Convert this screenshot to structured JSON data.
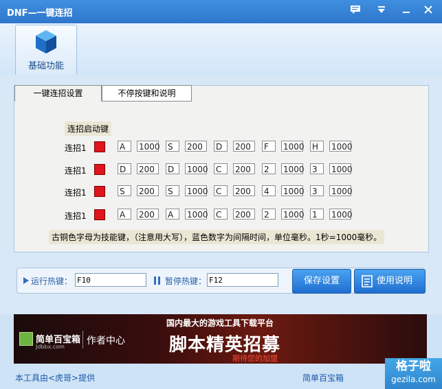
{
  "window": {
    "title": "DNF—一键连招"
  },
  "ribbon": {
    "tab_label": "基础功能"
  },
  "tabs": [
    {
      "label": "一键连招设置"
    },
    {
      "label": "不停按键和说明"
    }
  ],
  "combo": {
    "header": "连招启动键",
    "rows": [
      {
        "label": "连招1",
        "keys": [
          "A",
          "S",
          "D",
          "F",
          "H"
        ],
        "delays": [
          "1000",
          "200",
          "200",
          "1000",
          "1000"
        ]
      },
      {
        "label": "连招1",
        "keys": [
          "D",
          "D",
          "C",
          "2",
          "3"
        ],
        "delays": [
          "200",
          "1000",
          "200",
          "1000",
          "1000"
        ]
      },
      {
        "label": "连招1",
        "keys": [
          "S",
          "S",
          "C",
          "4",
          "3"
        ],
        "delays": [
          "200",
          "1000",
          "200",
          "1000",
          "1000"
        ]
      },
      {
        "label": "连招1",
        "keys": [
          "A",
          "A",
          "C",
          "2",
          "1"
        ],
        "delays": [
          "200",
          "1000",
          "200",
          "1000",
          "1000"
        ]
      }
    ],
    "note": "古铜色字母为技能键，（注意用大写），蓝色数字为间隔时间，单位毫秒。1秒=1000毫秒。"
  },
  "hotkeys": {
    "run_label": "运行热键：",
    "run_value": "F10",
    "pause_label": "暂停热键：",
    "pause_value": "F12",
    "save_button": "保存设置",
    "help_button": "使用说明"
  },
  "banner": {
    "brand": "简单百宝箱",
    "brand_sub": "Jdbbx.com",
    "author": "作者中心",
    "tagline": "国内最大的游戏工具下载平台",
    "headline": "脚本精英招募",
    "sub": "期待您的加盟"
  },
  "footer": {
    "left": "本工具由<虎哥>提供",
    "right": "简单百宝箱"
  },
  "watermark": {
    "line1": "格子啦",
    "line2": "gezila.com"
  }
}
